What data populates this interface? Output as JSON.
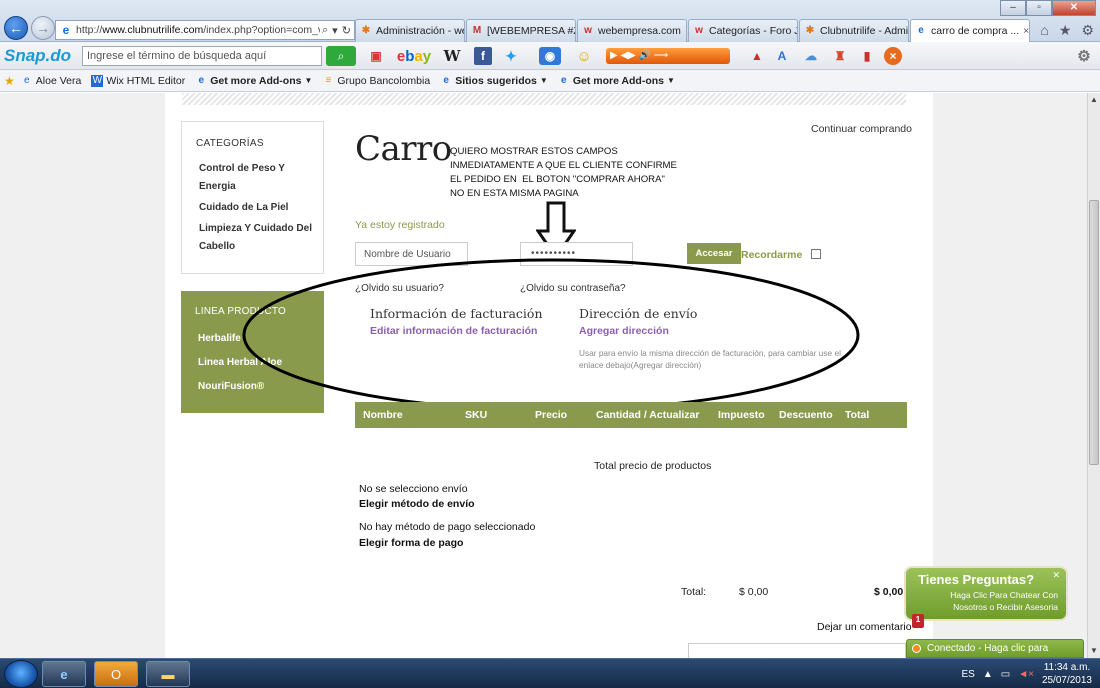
{
  "browser": {
    "url_host": "www.clubnutrilife.com",
    "url_path": "/index.php?option=com_virt",
    "tabs": [
      {
        "label": "Administración - we...",
        "icon": "joomla-icon"
      },
      {
        "label": "[WEBEMPRESA #ZX...",
        "icon": "gmail-icon"
      },
      {
        "label": "webempresa.com",
        "icon": "webempresa-icon"
      },
      {
        "label": "Categorías - Foro Jo...",
        "icon": "webempresa-icon"
      },
      {
        "label": "Clubnutrilife - Admi...",
        "icon": "joomla-icon"
      },
      {
        "label": "carro de compra ...",
        "icon": "ie-icon"
      }
    ],
    "search_placeholder": "Ingrese el término de búsqueda aquí",
    "snap_logo": "Snap.do",
    "favorites": [
      {
        "label": "Aloe Vera",
        "dropdown": false
      },
      {
        "label": "Wix HTML Editor",
        "dropdown": false
      },
      {
        "label": "Get more Add-ons",
        "dropdown": true
      },
      {
        "label": "Grupo Bancolombia",
        "dropdown": false
      },
      {
        "label": "Sitios sugeridos",
        "dropdown": true
      },
      {
        "label": "Get more Add-ons",
        "dropdown": true
      }
    ]
  },
  "sidebar": {
    "categories_title": "CATEGORÍAS",
    "categories": [
      "Control de Peso Y Energia",
      "Cuidado de La Piel",
      "Limpieza Y Cuidado Del Cabello"
    ],
    "products_title": "LINEA PRODUCTO",
    "products": [
      "Herbalife",
      "Linea Herbal Aloe",
      "NouriFusion®"
    ]
  },
  "cart": {
    "continue_link": "Continuar comprando",
    "title": "Carro",
    "note": "QUIERO MOSTRAR ESTOS CAMPOS\nINMEDIATAMENTE A QUE EL CLIENTE CONFIRME\nEL PEDIDO EN  EL BOTON \"COMPRAR AHORA\"\nNO EN ESTA MISMA PAGINA",
    "registered_label": "Ya estoy registrado",
    "username_placeholder": "Nombre de Usuario",
    "password_value": "••••••••••",
    "login_button": "Accesar",
    "remember_label": "Recordarme",
    "forgot_user": "¿Olvido su usuario?",
    "forgot_password": "¿Olvido su contraseña?",
    "billing_title": "Información de facturación",
    "billing_link": "Editar información de facturación",
    "shipping_title": "Dirección de envío",
    "shipping_link": "Agregar dirección",
    "shipping_note": "Usar para envío la misma dirección de facturación, para cambiar use el enlace debajo(Agregar dirección)",
    "columns": [
      "Nombre",
      "SKU",
      "Precio",
      "Cantidad / Actualizar",
      "Impuesto",
      "Descuento",
      "Total"
    ],
    "total_products_label": "Total precio de productos",
    "no_shipping": "No se selecciono envío",
    "choose_shipping": "Elegir método de envío",
    "no_payment": "No hay método de pago seleccionado",
    "choose_payment": "Elegir forma de pago",
    "total_label": "Total:",
    "total_tax": "$ 0,00",
    "total_amount": "$ 0,00",
    "comment_label": "Dejar un comentario"
  },
  "chat": {
    "title": "Tienes Preguntas?",
    "subtitle": "Haga Clic Para Chatear Con Nosotros o Recibir Asesoria",
    "badge": "1",
    "status": "Conectado - Haga clic para chatear"
  },
  "taskbar": {
    "language": "ES",
    "time": "11:34 a.m.",
    "date": "25/07/2013"
  },
  "colors": {
    "accent_green": "#8a9a4c",
    "link_purple": "#8b5fb0"
  }
}
